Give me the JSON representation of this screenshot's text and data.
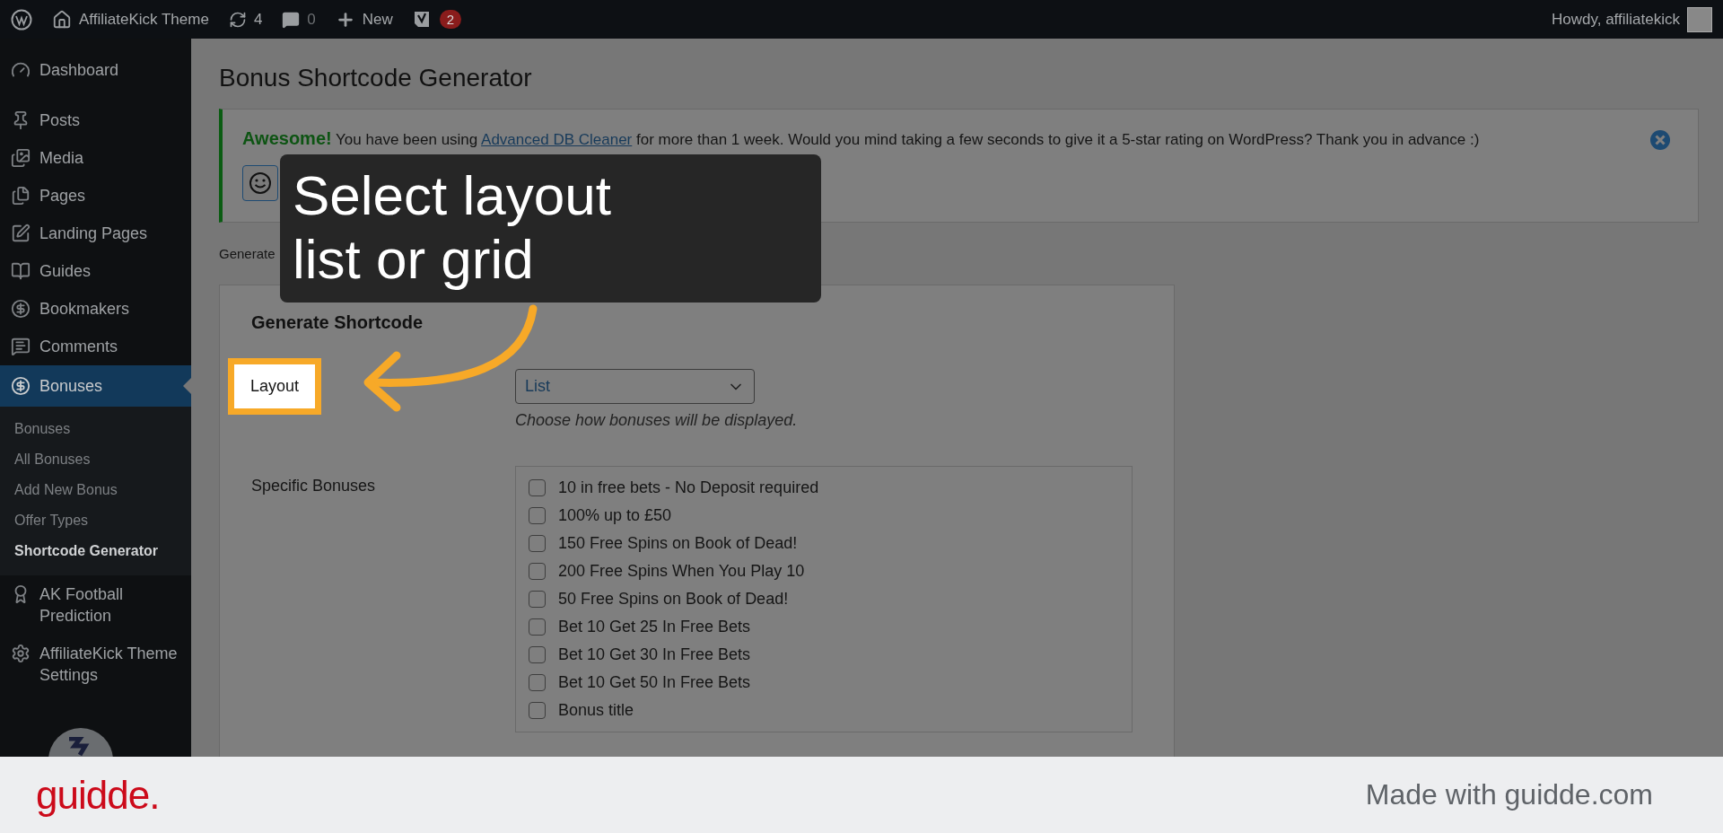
{
  "admin_bar": {
    "site": "AffiliateKick Theme",
    "updates": "4",
    "comments": "0",
    "new": "New",
    "seo_badge": "2",
    "greeting": "Howdy, affiliatekick"
  },
  "sidebar": {
    "items": [
      {
        "label": "Dashboard",
        "selected": false
      },
      {
        "label": "Posts",
        "selected": false
      },
      {
        "label": "Media",
        "selected": false
      },
      {
        "label": "Pages",
        "selected": false
      },
      {
        "label": "Landing Pages",
        "selected": false
      },
      {
        "label": "Guides",
        "selected": false
      },
      {
        "label": "Bookmakers",
        "selected": false
      },
      {
        "label": "Comments",
        "selected": false
      },
      {
        "label": "Bonuses",
        "selected": true,
        "children": [
          {
            "label": "Bonuses",
            "selected": false
          },
          {
            "label": "All Bonuses",
            "selected": false
          },
          {
            "label": "Add New Bonus",
            "selected": false
          },
          {
            "label": "Offer Types",
            "selected": false
          },
          {
            "label": "Shortcode Generator",
            "selected": true
          }
        ]
      },
      {
        "label": "AK Football Prediction",
        "selected": false
      },
      {
        "label": "AffiliateKick Theme Settings",
        "selected": false
      }
    ]
  },
  "page": {
    "title": "Bonus Shortcode Generator",
    "notice": {
      "highlight": "Awesome!",
      "text_before": "You have been using",
      "link": "Advanced DB Cleaner",
      "text_after": "for more than 1 week. Would you mind taking a few seconds to give it a 5-star rating on WordPress? Thank you in advance :)"
    },
    "intro": "Generate",
    "form": {
      "title": "Generate Shortcode",
      "fields": [
        {
          "kind": "select",
          "label": "Layout",
          "highlighted": true,
          "value": "List",
          "description": "Choose how bonuses will be displayed."
        },
        {
          "kind": "checklist",
          "label": "Specific Bonuses",
          "highlighted": false,
          "options": [
            {
              "label": "10 in free bets - No Deposit required",
              "checked": false
            },
            {
              "label": "100% up to £50",
              "checked": false
            },
            {
              "label": "150 Free Spins on Book of Dead!",
              "checked": false
            },
            {
              "label": "200 Free Spins When You Play 10",
              "checked": false
            },
            {
              "label": "50 Free Spins on Book of Dead!",
              "checked": false
            },
            {
              "label": "Bet 10 Get 25 In Free Bets",
              "checked": false
            },
            {
              "label": "Bet 10 Get 30 In Free Bets",
              "checked": false
            },
            {
              "label": "Bet 10 Get 50 In Free Bets",
              "checked": false
            },
            {
              "label": "Bonus title",
              "checked": false
            }
          ]
        }
      ]
    }
  },
  "callout": {
    "text": "Select layout list or grid"
  },
  "footer": {
    "logo": "guidde.",
    "credit": "Made with guidde.com"
  }
}
